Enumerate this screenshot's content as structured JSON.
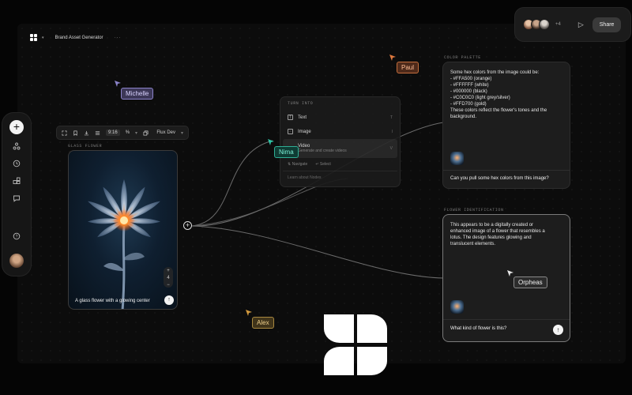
{
  "doc": {
    "title": "Brand Asset Generator",
    "menu_dots": "···"
  },
  "share_bar": {
    "more_count": "+4",
    "share_label": "Share"
  },
  "node": {
    "section_label": "GLASS FLOWER",
    "ratio": "9:16",
    "model": "Flux Dev",
    "caption": "A glass flower with a glowing center",
    "zoom_plus": "+",
    "zoom_level": "4",
    "zoom_minus": "−"
  },
  "turn_menu": {
    "header": "TURN INTO",
    "items": [
      {
        "label": "Text",
        "key": "T",
        "icon": "text-icon"
      },
      {
        "label": "Image",
        "key": "I",
        "icon": "image-icon"
      },
      {
        "label": "Video",
        "sub": "Generate and create videos",
        "key": "V",
        "icon": "video-icon"
      }
    ],
    "navigate": "Navigate",
    "select": "Select",
    "learn": "Learn about Nodes"
  },
  "palette": {
    "section_label": "COLOR PALETTE",
    "lines": [
      "Some hex colors from the image could be:",
      "",
      "- #FFA500 (orange)",
      "- #FFFFFF (white)",
      "- #000000 (black)",
      "- #C0C0C0 (light grey/silver)",
      "- #FFD700 (gold)",
      "",
      "These colors reflect the flower's tones and the",
      "background."
    ],
    "question": "Can you pull some hex colors from this image?"
  },
  "flower_id": {
    "section_label": "FLOWER IDENTIFICATION",
    "lines": [
      "This appears to be a digitally created or",
      "enhanced image of a flower that resembles a",
      "lotus. The design features glowing and",
      "translucent elements."
    ],
    "question": "What kind of flower is this?"
  },
  "cursors": {
    "michelle": {
      "name": "Michelle",
      "color": "#8b83c9"
    },
    "paul": {
      "name": "Paul",
      "color": "#e07a3f"
    },
    "nima": {
      "name": "Nima",
      "color": "#2fc4a6"
    },
    "alex": {
      "name": "Alex",
      "color": "#d39a3e"
    },
    "orpheus": {
      "name": "Orpheas",
      "color": "#e8e8e8"
    }
  }
}
